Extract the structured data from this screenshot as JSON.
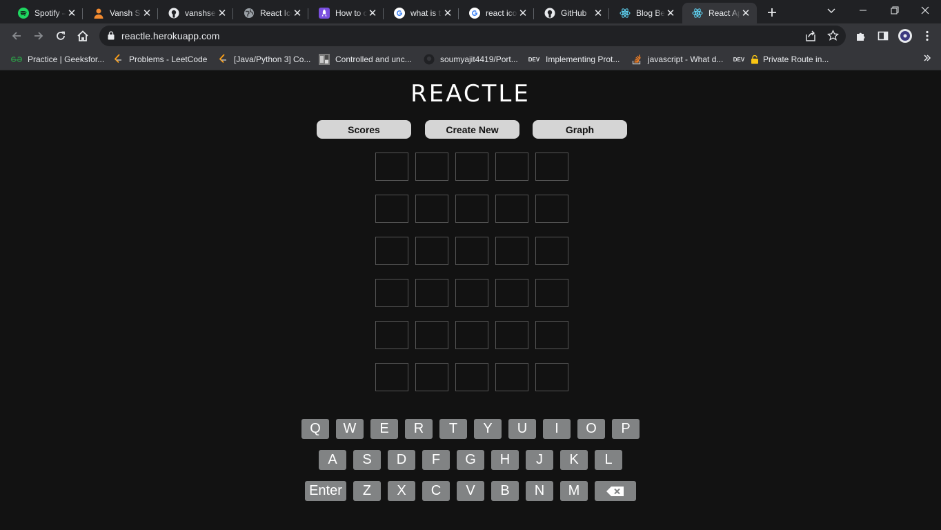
{
  "browser": {
    "tabs": [
      {
        "title": "Spotify – ",
        "icon": "spotify-icon"
      },
      {
        "title": "Vansh Se",
        "icon": "user-avatar-icon"
      },
      {
        "title": "vanshse",
        "icon": "github-icon"
      },
      {
        "title": "React Ico",
        "icon": "globe-icon"
      },
      {
        "title": "How to c",
        "icon": "rocket-icon"
      },
      {
        "title": "what is t",
        "icon": "google-icon"
      },
      {
        "title": "react ico",
        "icon": "google-icon"
      },
      {
        "title": "GitHub",
        "icon": "github-icon"
      },
      {
        "title": "Blog Bec",
        "icon": "react-icon"
      },
      {
        "title": "React Ap",
        "icon": "react-icon",
        "active": true
      }
    ],
    "url": "reactle.herokuapp.com",
    "bookmarks": [
      {
        "label": "Practice | Geeksfor...",
        "icon": "geeksforgeeks-icon"
      },
      {
        "label": "Problems - LeetCode",
        "icon": "leetcode-icon"
      },
      {
        "label": "[Java/Python 3] Co...",
        "icon": "leetcode-icon"
      },
      {
        "label": "Controlled and unc...",
        "icon": "image-icon"
      },
      {
        "label": "soumyajit4419/Port...",
        "icon": "github-icon"
      },
      {
        "label": "Implementing Prot...",
        "icon": "dev-icon",
        "icon_text": "DEV"
      },
      {
        "label": "javascript - What d...",
        "icon": "stackoverflow-icon"
      },
      {
        "label": "Private Route in...",
        "icon": "dev-icon",
        "icon_text": "DEV"
      }
    ]
  },
  "app": {
    "title": "REACTLE",
    "buttons": {
      "scores": "Scores",
      "create_new": "Create New",
      "graph": "Graph"
    },
    "grid": {
      "rows": 6,
      "cols": 5
    },
    "keyboard": {
      "row1": [
        "Q",
        "W",
        "E",
        "R",
        "T",
        "Y",
        "U",
        "I",
        "O",
        "P"
      ],
      "row2": [
        "A",
        "S",
        "D",
        "F",
        "G",
        "H",
        "J",
        "K",
        "L"
      ],
      "row3": [
        "Enter",
        "Z",
        "X",
        "C",
        "V",
        "B",
        "N",
        "M"
      ]
    }
  }
}
